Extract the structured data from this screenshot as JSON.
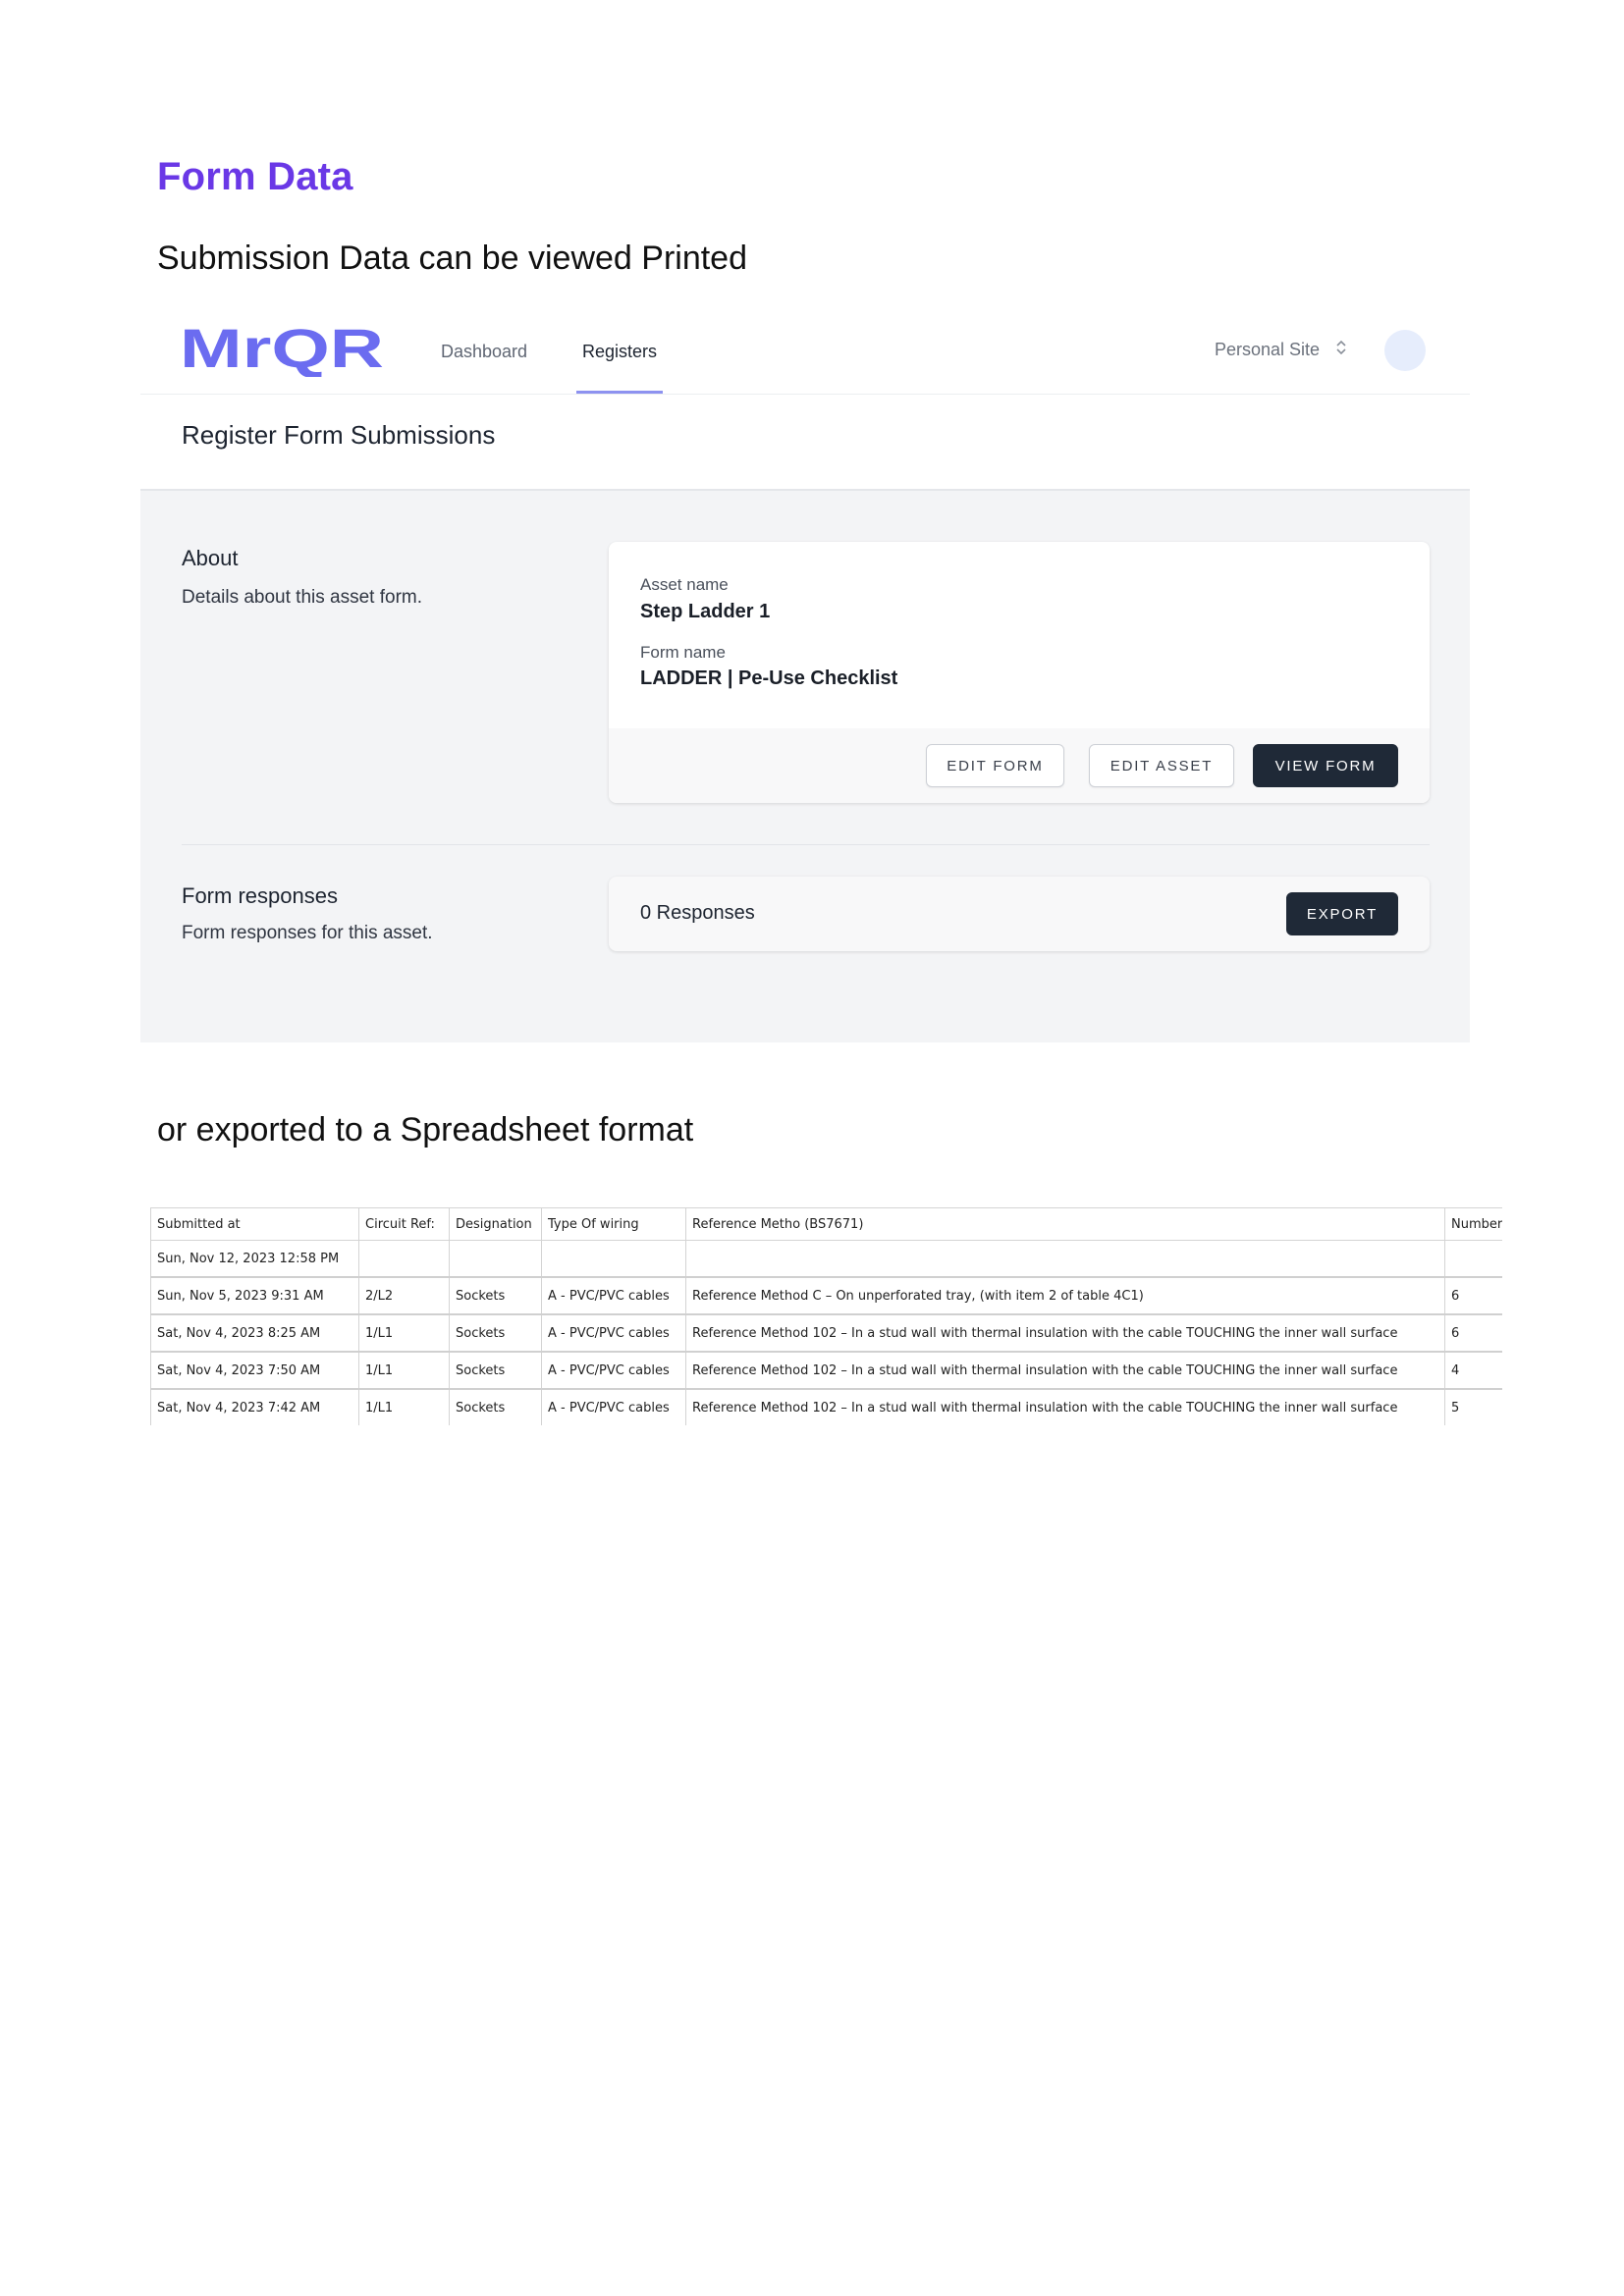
{
  "document": {
    "title": "Form Data",
    "subtitle_printed": "Submission Data can be viewed Printed",
    "subtitle_export": "or exported to a Spreadsheet format"
  },
  "app": {
    "logo_text": "MrQR",
    "nav": {
      "dashboard": "Dashboard",
      "registers": "Registers"
    },
    "site_switcher": "Personal Site",
    "page_title": "Register Form Submissions",
    "about": {
      "heading": "About",
      "description": "Details about this asset form.",
      "asset_name_label": "Asset name",
      "asset_name_value": "Step Ladder 1",
      "form_name_label": "Form name",
      "form_name_value": "LADDER | Pe-Use Checklist",
      "buttons": {
        "edit_form": "EDIT FORM",
        "edit_asset": "EDIT ASSET",
        "view_form": "VIEW FORM"
      }
    },
    "responses": {
      "heading": "Form responses",
      "description": "Form responses for this asset.",
      "count_text": "0 Responses",
      "export_button": "EXPORT"
    },
    "colors": {
      "title_purple": "#6a38e6",
      "logo_blue": "#6b6cf0",
      "dark_button": "#1f2937",
      "tab_underline": "#8d92f0"
    }
  },
  "spreadsheet": {
    "columns": [
      "Submitted at",
      "Circuit Ref:",
      "Designation",
      "Type Of wiring",
      "Reference Metho (BS7671)",
      "Number"
    ],
    "rows": [
      [
        "Sun, Nov 12, 2023 12:58 PM",
        "",
        "",
        "",
        "",
        ""
      ],
      [
        "Sun, Nov 5, 2023 9:31 AM",
        "2/L2",
        "Sockets",
        "A - PVC/PVC cables",
        "Reference Method C – On unperforated tray, (with item 2 of table 4C1)",
        "6"
      ],
      [
        "Sat, Nov 4, 2023 8:25 AM",
        "1/L1",
        "Sockets",
        "A - PVC/PVC cables",
        "Reference Method 102 – In a stud wall with thermal insulation with the cable TOUCHING the inner wall surface",
        "6"
      ],
      [
        "Sat, Nov 4, 2023 7:50 AM",
        "1/L1",
        "Sockets",
        "A - PVC/PVC cables",
        "Reference Method 102 – In a stud wall with thermal insulation with the cable TOUCHING the inner wall surface",
        "4"
      ],
      [
        "Sat, Nov 4, 2023 7:42 AM",
        "1/L1",
        "Sockets",
        "A - PVC/PVC cables",
        "Reference Method 102 – In a stud wall with thermal insulation with the cable TOUCHING the inner wall surface",
        "5"
      ]
    ]
  }
}
